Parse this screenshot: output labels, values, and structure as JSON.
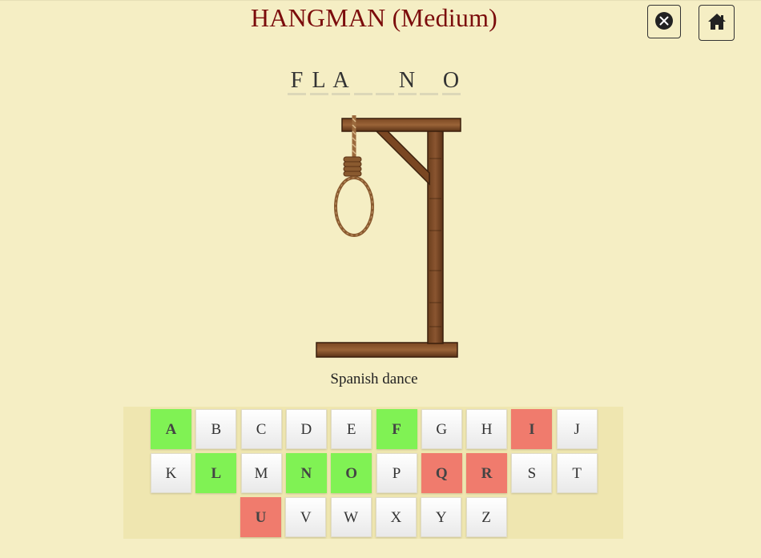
{
  "title": "HANGMAN (Medium)",
  "buttons": {
    "close_icon": "close-circle-icon",
    "home_icon": "home-icon"
  },
  "word_slots": [
    "F",
    "L",
    "A",
    "",
    "",
    "N",
    "",
    "O"
  ],
  "clue": "Spanish dance",
  "keyboard": {
    "rows": [
      [
        "A",
        "B",
        "C",
        "D",
        "E",
        "F",
        "G",
        "H",
        "I",
        "J"
      ],
      [
        "K",
        "L",
        "M",
        "N",
        "O",
        "P",
        "Q",
        "R",
        "S",
        "T"
      ],
      [
        "U",
        "V",
        "W",
        "X",
        "Y",
        "Z"
      ]
    ],
    "correct": [
      "A",
      "F",
      "L",
      "N",
      "O"
    ],
    "wrong": [
      "I",
      "Q",
      "R",
      "U"
    ]
  },
  "colors": {
    "background": "#f5eec4",
    "title": "#7b0c0c",
    "correct": "#80f254",
    "wrong": "#f07b6d"
  }
}
